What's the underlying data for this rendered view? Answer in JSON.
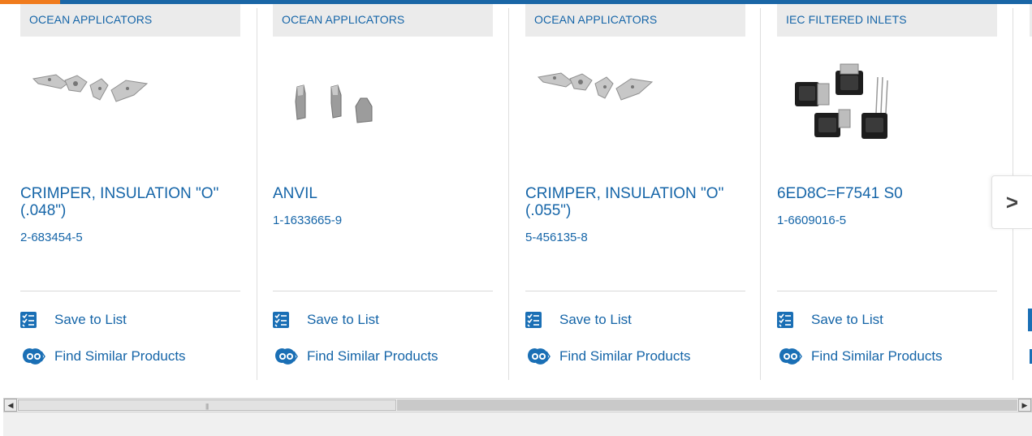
{
  "products": [
    {
      "category": "OCEAN APPLICATORS",
      "title": "CRIMPER, INSULATION \"O\"(.048\")",
      "part_number": "2-683454-5",
      "save_label": "Save to List",
      "similar_label": "Find Similar Products",
      "image_icon": "crimper-parts-image"
    },
    {
      "category": "OCEAN APPLICATORS",
      "title": "ANVIL",
      "part_number": "1-1633665-9",
      "save_label": "Save to List",
      "similar_label": "Find Similar Products",
      "image_icon": "anvil-parts-image"
    },
    {
      "category": "OCEAN APPLICATORS",
      "title": "CRIMPER, INSULATION \"O\"(.055\")",
      "part_number": "5-456135-8",
      "save_label": "Save to List",
      "similar_label": "Find Similar Products",
      "image_icon": "crimper-parts-image"
    },
    {
      "category": "IEC FILTERED INLETS",
      "title": "6ED8C=F7541 S0",
      "part_number": "1-6609016-5",
      "save_label": "Save to List",
      "similar_label": "Find Similar Products",
      "image_icon": "iec-inlet-image"
    }
  ],
  "carousel": {
    "next_icon": "chevron-right-icon",
    "next_glyph": ">"
  },
  "colors": {
    "brand_blue": "#1565a8",
    "accent_orange": "#f07b1d",
    "category_bg": "#ebebeb"
  }
}
